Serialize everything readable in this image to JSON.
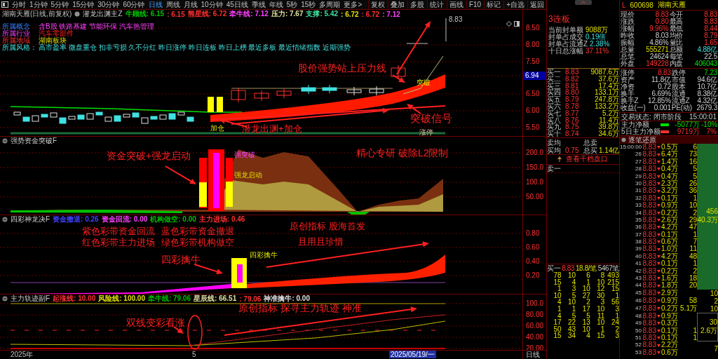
{
  "toolbar": {
    "periods": [
      {
        "label": "分时",
        "selected": false
      },
      {
        "label": "1分钟",
        "selected": false
      },
      {
        "label": "5分钟",
        "selected": false
      },
      {
        "label": "15分钟",
        "selected": false
      },
      {
        "label": "30分钟",
        "selected": false
      },
      {
        "label": "60分钟",
        "selected": false
      },
      {
        "label": "日线",
        "selected": true
      },
      {
        "label": "周线",
        "selected": false
      },
      {
        "label": "月线",
        "selected": false
      },
      {
        "label": "10分钟",
        "selected": false
      },
      {
        "label": "45日线",
        "selected": false
      },
      {
        "label": "季线",
        "selected": false
      },
      {
        "label": "年线",
        "selected": false
      },
      {
        "label": "5秒",
        "selected": false
      },
      {
        "label": "15秒",
        "selected": false
      },
      {
        "label": "多周期",
        "selected": false
      },
      {
        "label": "更多>",
        "selected": false
      }
    ],
    "tools": [
      "复权",
      "叠加",
      "多股",
      "统计",
      "画线",
      "F10",
      "标记",
      "+自选",
      "返回"
    ]
  },
  "panels": [
    {
      "kind": "price",
      "title": "湖南天雁(日线,前复权)",
      "indicator": "潜龙出渊主Z",
      "legend": [
        {
          "text": "牛顾线: 6.15",
          "color": "#00c000"
        },
        {
          "text": ": 6.15",
          "color": "#ff3030"
        },
        {
          "text": "熊星线: 6.72",
          "color": "#ff3030"
        },
        {
          "text": "牵牛线: 7.12",
          "color": "#ff40ff"
        },
        {
          "text": "压力: 7.67",
          "color": "#e0e0a0"
        },
        {
          "text": "支撑: 5.42",
          "color": "#40e0a0"
        },
        {
          "text": ": 6.72",
          "color": "#e0e000"
        },
        {
          "text": ": 6.72",
          "color": "#ff3030"
        },
        {
          "text": ": 7.12",
          "color": "#ff40ff"
        }
      ],
      "info": [
        {
          "label": "所属概念",
          "value": "含B股 铁路基建 节能环保 汽车热管理"
        },
        {
          "label": "所属行业",
          "value": "汽车零部件"
        },
        {
          "label": "所属地域",
          "value": "湖南板块"
        },
        {
          "label": "所属风格：",
          "value": "高市盈率 微盘重仓 扣非亏损 久不分红 昨日涨停 昨日连板 昨日上榜 最近多板 最近情绪指数 近期强势"
        }
      ],
      "y_labels": [
        {
          "text": "8.50",
          "kind": "tick"
        },
        {
          "text": "8.00",
          "kind": "tick"
        },
        {
          "text": "7.50",
          "kind": "tick"
        },
        {
          "text": "6.94",
          "kind": "current"
        },
        {
          "text": "6.50",
          "kind": "tick"
        },
        {
          "text": "6.00",
          "kind": "tick"
        },
        {
          "text": "5.50",
          "kind": "tick"
        }
      ],
      "high_label": "8.83",
      "annotations": [
        "股价强势站上压力线",
        "突破信号",
        "潜龙出渊+加仓"
      ],
      "marks": [
        "突破",
        "涨停",
        "加仓"
      ]
    },
    {
      "kind": "flow",
      "title": "强势资金突破F",
      "y_labels": [
        {
          "text": "200.0",
          "kind": "tick"
        },
        {
          "text": "150.0",
          "kind": "tick"
        },
        {
          "text": "100.0",
          "kind": "tick"
        },
        {
          "text": "50.00",
          "kind": "tick"
        }
      ],
      "annotations": [
        "资金突破+强龙启动",
        "精心专研 破除L2限制"
      ],
      "marks": [
        "强突破",
        "强龙启动"
      ]
    },
    {
      "kind": "band",
      "title": "四彩神龙决F",
      "legend": [
        {
          "text": "资金撤退: 0.26",
          "color": "#4040ff"
        },
        {
          "text": "资金回流: 0.00",
          "color": "#ff40ff"
        },
        {
          "text": "机构做空: 0.00",
          "color": "#00c000"
        },
        {
          "text": "主力进场: 0.46",
          "color": "#ff3030"
        }
      ],
      "y_labels": [
        {
          "text": "0.80",
          "kind": "tick"
        },
        {
          "text": "0.60",
          "kind": "tick"
        },
        {
          "text": "0.40",
          "kind": "tick"
        },
        {
          "text": "0.20",
          "kind": "tick"
        }
      ],
      "annotations": [
        "紫色彩带资金回流",
        "红色彩带主力进场",
        "蓝色彩带资金撤退",
        "绿色彩带机构做空",
        "原创指标 股海首发",
        "且用且珍惜",
        "四彩擒牛"
      ],
      "marks": [
        "四彩擒牛"
      ]
    },
    {
      "kind": "track",
      "title": "主力轨迹副F",
      "legend": [
        {
          "text": "起涨线: 10.00",
          "color": "#ff3030"
        },
        {
          "text": "风险线: 100.00",
          "color": "#e0e000"
        },
        {
          "text": "牵牛线: 79.06",
          "color": "#00c000"
        },
        {
          "text": "星辰线: 66.51",
          "color": "#e0e0a0"
        },
        {
          "text": ": 79.06",
          "color": "#ff3030"
        },
        {
          "text": "神准擒牛: 0.00",
          "color": "#e0e0e0"
        }
      ],
      "y_labels": [
        {
          "text": "100.0",
          "kind": "tick"
        },
        {
          "text": "80.00",
          "kind": "tick"
        },
        {
          "text": "60.00",
          "kind": "tick"
        },
        {
          "text": "40.00",
          "kind": "tick"
        },
        {
          "text": "20.00",
          "kind": "tick"
        }
      ],
      "annotations": [
        "原创指标 探寻主力轨迹 神准",
        "双线变彩看涨"
      ]
    }
  ],
  "time_axis": {
    "labels": [
      {
        "text": "2025年",
        "kind": "plain"
      },
      {
        "text": "5",
        "kind": "plain"
      },
      {
        "text": "2025/05/19/一",
        "kind": "cursor"
      }
    ],
    "period": "日线"
  },
  "quote_panel": {
    "market": "L",
    "code": "600698",
    "name": "湖南天雁",
    "seal": {
      "streak": "3连板",
      "items": [
        {
          "label": "当前封单额",
          "value": "9088万",
          "kind": "volume"
        },
        {
          "label": "封单占成交",
          "value": "0.19倍",
          "kind": "amount"
        },
        {
          "label": "封单占流通Z",
          "value": "2.38%",
          "kind": "amount"
        },
        {
          "label": "十日总涨幅",
          "value": "37.11%",
          "kind": "up"
        }
      ]
    },
    "quotes": [
      {
        "label": "现价",
        "value": "8.83",
        "kind": "up"
      },
      {
        "label": "今开",
        "value": "8.83",
        "kind": "up"
      },
      {
        "label": "涨跌",
        "value": "0.80",
        "kind": "up"
      },
      {
        "label": "最高",
        "value": "8.83",
        "kind": "up"
      },
      {
        "label": "涨幅",
        "value": "9.96%",
        "kind": "up"
      },
      {
        "label": "最低",
        "value": "8.44",
        "kind": "up"
      },
      {
        "label": "昨收",
        "value": "8.03",
        "kind": "flat"
      },
      {
        "label": "均价",
        "value": "8.79",
        "kind": "up"
      },
      {
        "label": "振幅",
        "value": "4.86%",
        "kind": "flat"
      },
      {
        "label": "量比",
        "value": "1.65",
        "kind": "up"
      },
      {
        "label": "总量",
        "value": "555271",
        "kind": "volume"
      },
      {
        "label": "总额",
        "value": "4.88亿",
        "kind": "amount"
      },
      {
        "label": "总笔",
        "value": "24624",
        "kind": "flat"
      },
      {
        "label": "每笔",
        "value": "22.5",
        "kind": "flat"
      },
      {
        "label": "外盘",
        "value": "149228",
        "kind": "up"
      },
      {
        "label": "内盘",
        "value": "406043",
        "kind": "down"
      }
    ],
    "bids": [
      {
        "label": "买一",
        "price": "8.83",
        "volume": "9087.6万"
      },
      {
        "label": "买二",
        "price": "8.82",
        "volume": "37.6万"
      },
      {
        "label": "买三",
        "price": "8.81",
        "volume": "17.4万"
      },
      {
        "label": "买四",
        "price": "8.80",
        "volume": "133.1万"
      },
      {
        "label": "买五",
        "price": "8.79",
        "volume": "247.8万"
      },
      {
        "label": "买六",
        "price": "8.78",
        "volume": "133.2万"
      },
      {
        "label": "买七",
        "price": "8.77",
        "volume": "5.2万"
      },
      {
        "label": "买八",
        "price": "8.76",
        "volume": "11.4万"
      },
      {
        "label": "买九",
        "price": "8.75",
        "volume": "39.8万"
      },
      {
        "label": "买十",
        "price": "8.74",
        "volume": "34.6万"
      }
    ],
    "stats": [
      {
        "label": "涨停",
        "value": "8.83",
        "kind": "up"
      },
      {
        "label": "跌停",
        "value": "7.23",
        "kind": "down"
      },
      {
        "label": "资产",
        "value": "11.8亿",
        "kind": "flat"
      },
      {
        "label": "市值",
        "value": "94.6亿",
        "kind": "flat"
      },
      {
        "label": "净资",
        "value": "0.72",
        "kind": "flat"
      },
      {
        "label": "股本",
        "value": "10.7亿",
        "kind": "flat"
      },
      {
        "label": "换手",
        "value": "6.69%",
        "kind": "flat"
      },
      {
        "label": "流通",
        "value": "8.38亿",
        "kind": "flat"
      },
      {
        "label": "换手Z",
        "value": "12.85%",
        "kind": "flat"
      },
      {
        "label": "流通Z",
        "value": "4.32亿",
        "kind": "flat"
      },
      {
        "label": "收益(一)",
        "value": "0.001",
        "kind": "flat"
      },
      {
        "label": "PE(动)",
        "value": "2679.3",
        "kind": "flat"
      }
    ],
    "status": {
      "label": "交易状态: 闭市阶段",
      "time": "15:00:01"
    },
    "flows": [
      {
        "label": "主力净额",
        "value": "-5077万",
        "pct": "-10%",
        "kind": "down"
      },
      {
        "label": "5日主力净额",
        "value": "9719万",
        "pct": "7%",
        "kind": "up"
      }
    ],
    "summary": [
      {
        "avg_label": "卖均",
        "total_label": "总卖"
      },
      {
        "avg_label": "买均",
        "avg": "0.75",
        "total_label": "总买",
        "total": "1.14亿"
      }
    ],
    "depth_button": "查看千档盘口",
    "ask_label": "卖一",
    "bid_queue": {
      "label": "买一",
      "price": "8.83",
      "per": "18.8/笔",
      "count": "5467笔",
      "rows": [
        [
          "78",
          "10",
          "6",
          "8",
          "493"
        ],
        [
          "15",
          "4",
          "1",
          "10",
          "215"
        ],
        [
          "1",
          "3",
          "10",
          "12",
          "15"
        ],
        [
          "10",
          "5",
          "27",
          "30",
          "1"
        ],
        [
          "4",
          "10",
          "2",
          "3",
          "56"
        ],
        [
          "1",
          "1",
          "17",
          "10",
          "3"
        ],
        [
          "4",
          "5",
          "5",
          "11",
          "1"
        ],
        [
          "17",
          "22",
          "13",
          "10",
          "24"
        ],
        [
          "50",
          "43",
          "10",
          "1",
          "2"
        ],
        [
          "15",
          "34",
          "4",
          "15",
          "3"
        ]
      ]
    },
    "ticks": {
      "title": "逐笔还原",
      "groups": [
        {
          "kind": "block",
          "count": "456",
          "volume": "40.3万",
          "ticks": [
            {
              "time": "15:00:00",
              "price": "8.83",
              "volume": "0.5万",
              "count": "6"
            },
            {
              "time": "26",
              "price": "8.83",
              "volume": "6.4万",
              "count": "73"
            },
            {
              "time": "27",
              "price": "8.83",
              "volume": "1.4万",
              "count": "16"
            },
            {
              "time": "28",
              "price": "8.83",
              "volume": "0.4万",
              "count": "5"
            },
            {
              "time": "29",
              "price": "8.83",
              "volume": "0.4万",
              "count": "5"
            },
            {
              "time": "30",
              "price": "8.83",
              "volume": "2.3万",
              "count": "26"
            },
            {
              "time": "31",
              "price": "8.83",
              "volume": "3.2万",
              "count": "36"
            },
            {
              "time": "32",
              "price": "8.83",
              "volume": "0.1万",
              "count": "1"
            },
            {
              "time": "33",
              "price": "8.83",
              "volume": "0.9万",
              "count": "10"
            },
            {
              "time": "34",
              "price": "8.83",
              "volume": "0.2万",
              "count": "2"
            },
            {
              "time": "35",
              "price": "8.83",
              "volume": "2.6万",
              "count": "29"
            },
            {
              "time": "36",
              "price": "8.83",
              "volume": "4.2万",
              "count": "47"
            },
            {
              "time": "37",
              "price": "8.83",
              "volume": "0.1万",
              "count": "1"
            },
            {
              "time": "38",
              "price": "8.83",
              "volume": "0.6万",
              "count": "7"
            },
            {
              "time": "39",
              "price": "8.83",
              "volume": "1.0万",
              "count": "11"
            },
            {
              "time": "40",
              "price": "8.83",
              "volume": "4.2万",
              "count": "48"
            },
            {
              "time": "41",
              "price": "8.83",
              "volume": "0.1万",
              "count": "1"
            },
            {
              "time": "42",
              "price": "8.83",
              "volume": "0.2万",
              "count": "2"
            },
            {
              "time": "43",
              "price": "8.83",
              "volume": "1.6万",
              "count": "18"
            },
            {
              "time": "44",
              "price": "8.83",
              "volume": "1.8万",
              "count": "20"
            }
          ]
        },
        {
          "kind": "plain",
          "count": "10",
          "ticks": [
            {
              "time": "45",
              "price": "8.83",
              "volume": "2.9万"
            }
          ]
        },
        {
          "kind": "plain",
          "count": "2",
          "ticks": [
            {
              "time": "46",
              "price": "8.83",
              "volume": "0.9万",
              "count": "58"
            }
          ]
        },
        {
          "kind": "plain",
          "count": "10",
          "ticks": [
            {
              "time": "47",
              "price": "8.83",
              "volume": "0.2万",
              "count": "5.1万"
            }
          ]
        },
        {
          "kind": "boxed",
          "count": "30",
          "volume": "2.6万",
          "ticks": [
            {
              "time": "48",
              "price": "8.83",
              "volume": "0.9万"
            },
            {
              "time": "49",
              "price": "8.83",
              "volume": "0.3万"
            },
            {
              "time": "50",
              "price": "8.83",
              "volume": "0.1万",
              "count": "1"
            },
            {
              "time": "51",
              "price": "8.83",
              "volume": "0.1万",
              "count": "1"
            }
          ]
        },
        {
          "kind": "plain",
          "count": "7",
          "ticks": [
            {
              "time": "52",
              "price": "8.83",
              "volume": "2.2万"
            },
            {
              "time": "53",
              "price": "8.83",
              "volume": "0.6万"
            }
          ]
        }
      ]
    }
  }
}
